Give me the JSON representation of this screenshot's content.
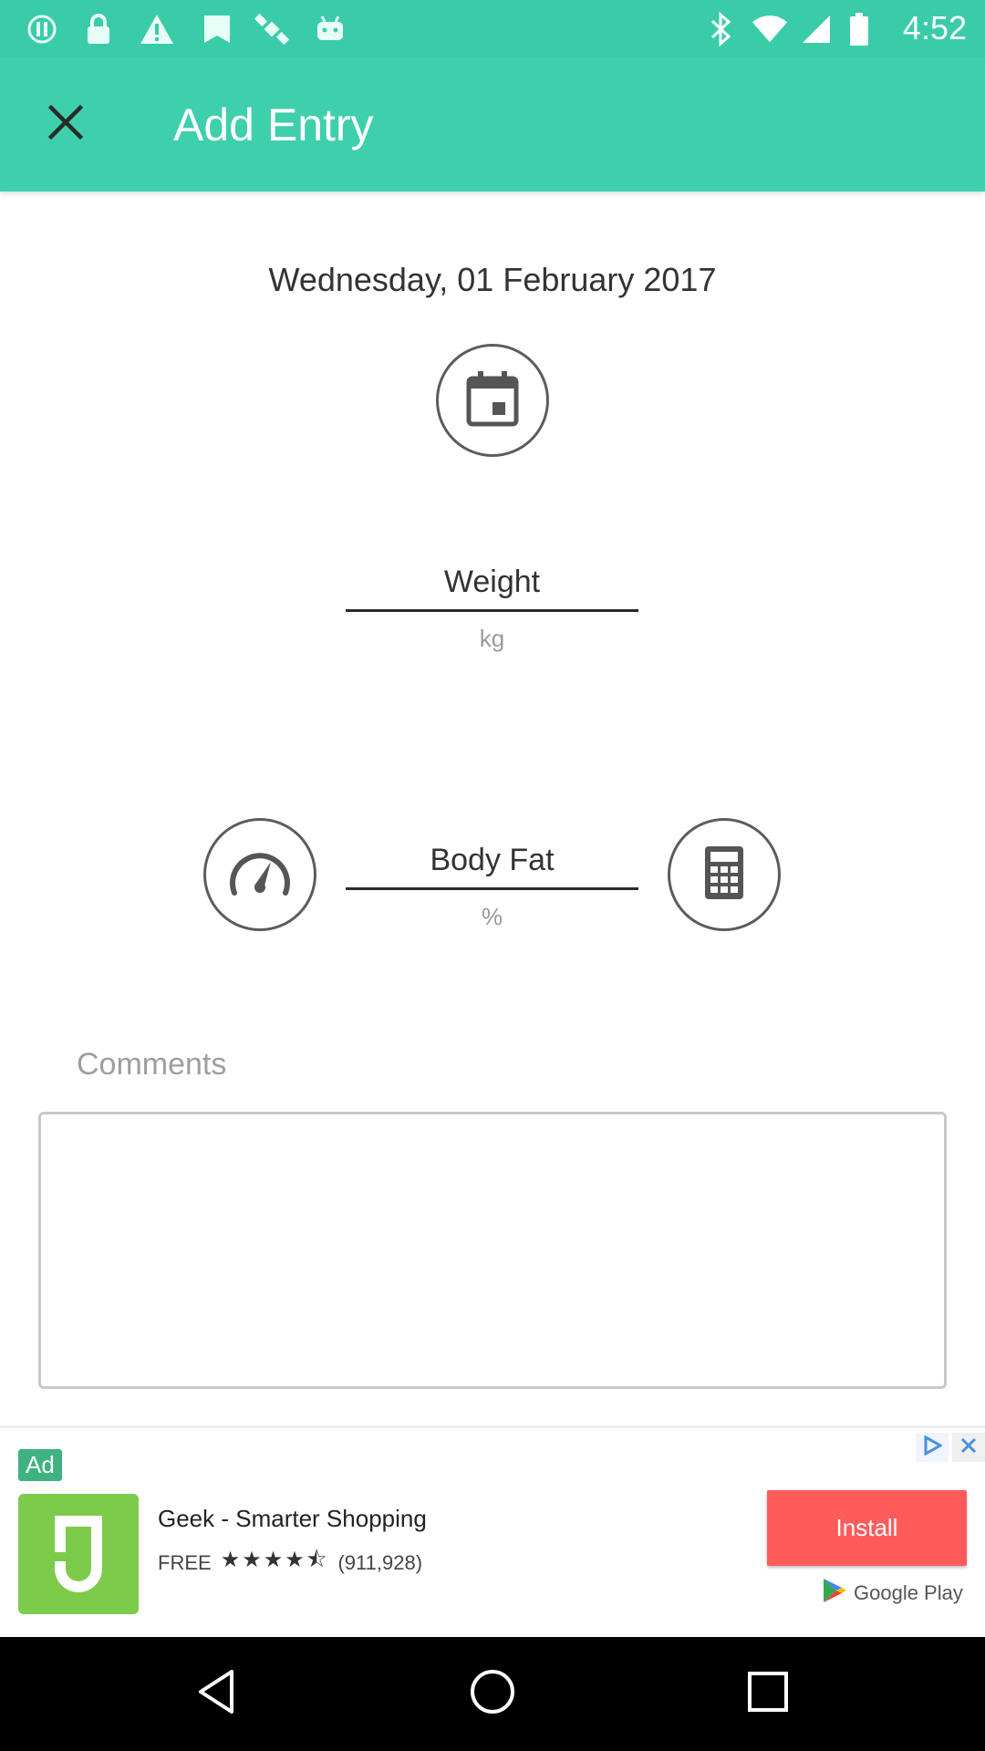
{
  "status_bar": {
    "time": "4:52",
    "icons": [
      "alert-circle-icon",
      "lock-icon",
      "warning-icon",
      "fake-gps-icon",
      "satellite-icon",
      "android-icon",
      "bluetooth-icon",
      "wifi-icon",
      "signal-icon",
      "battery-icon"
    ]
  },
  "app_bar": {
    "title": "Add Entry",
    "close_icon": "close-icon"
  },
  "entry": {
    "date": "Wednesday, 01 February 2017",
    "date_picker_icon": "calendar-icon",
    "weight": {
      "placeholder": "Weight",
      "unit": "kg"
    },
    "body_fat": {
      "placeholder": "Body Fat",
      "unit": "%",
      "left_icon": "speedometer-icon",
      "right_icon": "calculator-icon"
    },
    "comments": {
      "label": "Comments",
      "value": ""
    }
  },
  "ad": {
    "badge": "Ad",
    "app_name": "Geek - Smarter Shopping",
    "price": "FREE",
    "rating_count": "(911,928)",
    "rating": 4.5,
    "install_label": "Install",
    "store": "Google Play",
    "colors": {
      "install": "#ff5b5b",
      "logo": "#7ccb4a"
    }
  },
  "nav_bar": {
    "buttons": [
      "back-icon",
      "home-icon",
      "recents-icon"
    ]
  },
  "colors": {
    "primary": "#3ecfac",
    "status_bar": "#3acca9"
  }
}
